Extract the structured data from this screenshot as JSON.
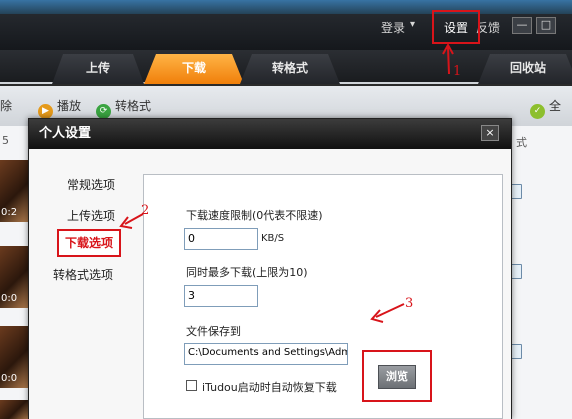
{
  "topbar": {
    "login": "登录",
    "dropdown_arrow": "▾",
    "settings": "设置",
    "feedback": "反馈",
    "minimize": "—",
    "maximize": "□"
  },
  "tabs": [
    {
      "label": "上传",
      "active": false
    },
    {
      "label": "下载",
      "active": true
    },
    {
      "label": "转格式",
      "active": false
    },
    {
      "label": "回收站",
      "active": false
    }
  ],
  "toolbar": {
    "left_fragment": "除",
    "play": "播放",
    "convert": "转格式",
    "select_all": "全"
  },
  "list": {
    "left_col_fragment": "5",
    "right_col_fragment": "式",
    "durations": [
      "0:2",
      "0:0",
      "0:0"
    ]
  },
  "dialog": {
    "title": "个人设置",
    "close": "×",
    "nav": [
      {
        "label": "常规选项",
        "selected": false
      },
      {
        "label": "上传选项",
        "selected": false
      },
      {
        "label": "下载选项",
        "selected": true
      },
      {
        "label": "转格式选项",
        "selected": false
      }
    ],
    "speed_label": "下载速度限制(0代表不限速)",
    "speed_value": "0",
    "speed_unit": "KB/S",
    "max_label": "同时最多下载(上限为10)",
    "max_value": "3",
    "path_label": "文件保存到",
    "path_value": "C:\\Documents and Settings\\Admi",
    "browse": "浏览",
    "resume_label": "iTudou启动时自动恢复下载"
  },
  "annotations": {
    "n1": "1",
    "n2": "2",
    "n3": "3",
    "color": "#d8141a"
  },
  "colors": {
    "active_tab": "#f59a23",
    "highlight": "#d8141a"
  }
}
